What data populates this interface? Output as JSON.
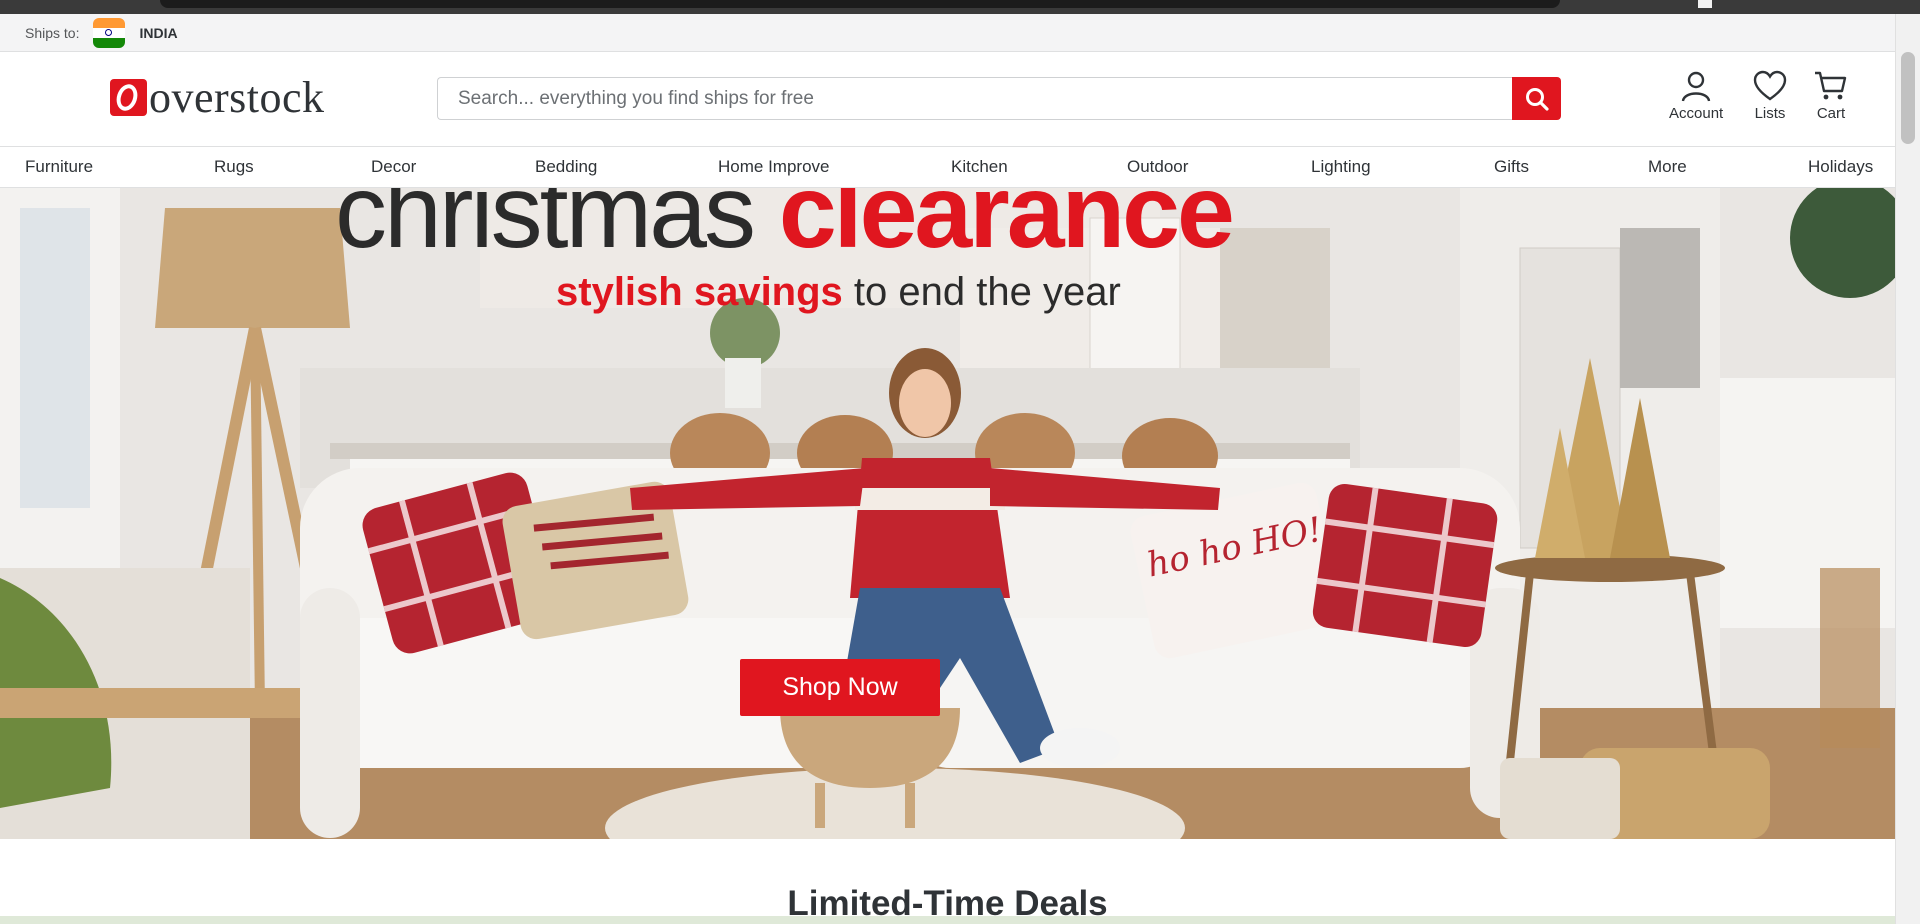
{
  "ships_to": {
    "label": "Ships to:",
    "country": "INDIA"
  },
  "brand": {
    "name": "overstock",
    "accent": "#e0161f"
  },
  "search": {
    "placeholder": "Search... everything you find ships for free",
    "value": ""
  },
  "header_actions": [
    {
      "label": "Account",
      "icon": "person-icon"
    },
    {
      "label": "Lists",
      "icon": "heart-icon"
    },
    {
      "label": "Cart",
      "icon": "cart-icon"
    }
  ],
  "nav": [
    "Furniture",
    "Rugs",
    "Decor",
    "Bedding",
    "Home Improve",
    "Kitchen",
    "Outdoor",
    "Lighting",
    "Gifts",
    "More",
    "Holidays"
  ],
  "hero": {
    "title_part1": "christmas ",
    "title_part2": "clearance",
    "subtitle_part1": "stylish savings",
    "subtitle_part2": " to end the year",
    "cta": "Shop Now",
    "pillow_text": "ho ho HO!"
  },
  "section": {
    "title": "Limited-Time Deals"
  }
}
